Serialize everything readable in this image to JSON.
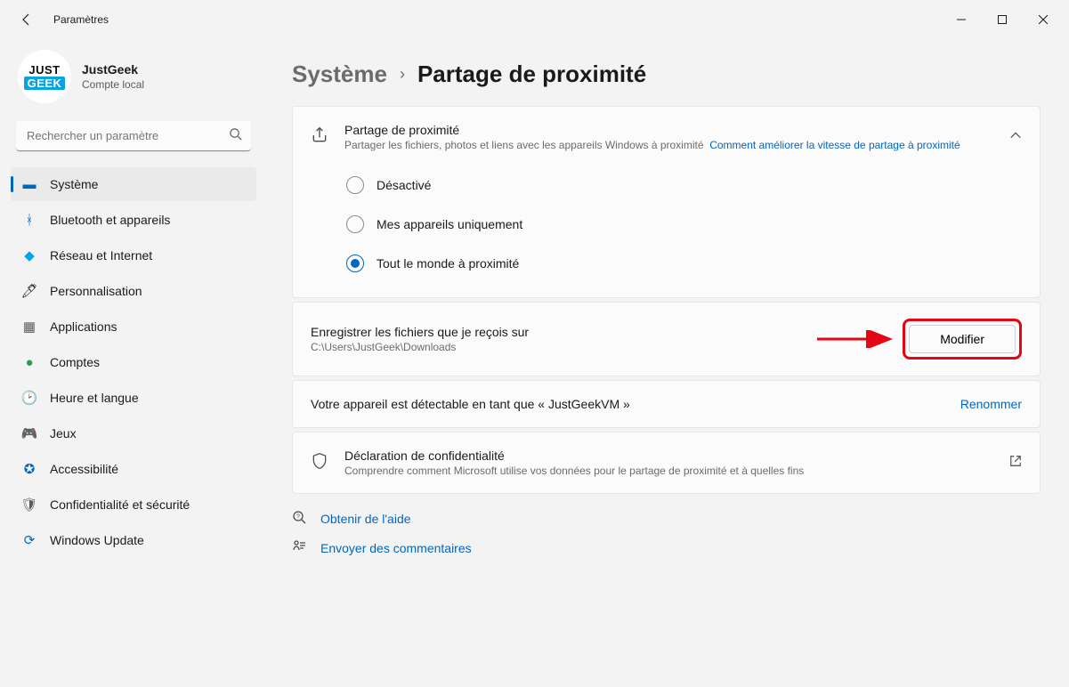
{
  "window": {
    "title": "Paramètres"
  },
  "profile": {
    "name": "JustGeek",
    "account_type": "Compte local",
    "logo_top": "JUST",
    "logo_bottom": "GEEK"
  },
  "search": {
    "placeholder": "Rechercher un paramètre"
  },
  "sidebar": {
    "items": [
      {
        "label": "Système",
        "icon": "🖥️"
      },
      {
        "label": "Bluetooth et appareils",
        "icon": "ᛒ"
      },
      {
        "label": "Réseau et Internet",
        "icon": "📶"
      },
      {
        "label": "Personnalisation",
        "icon": "🖌️"
      },
      {
        "label": "Applications",
        "icon": "▦"
      },
      {
        "label": "Comptes",
        "icon": "👤"
      },
      {
        "label": "Heure et langue",
        "icon": "🌐"
      },
      {
        "label": "Jeux",
        "icon": "🎮"
      },
      {
        "label": "Accessibilité",
        "icon": "♿"
      },
      {
        "label": "Confidentialité et sécurité",
        "icon": "🛡️"
      },
      {
        "label": "Windows Update",
        "icon": "🔄"
      }
    ]
  },
  "breadcrumb": {
    "root": "Système",
    "leaf": "Partage de proximité"
  },
  "main_card": {
    "title": "Partage de proximité",
    "subtitle": "Partager les fichiers, photos et liens avec les appareils Windows à proximité",
    "link": "Comment améliorer la vitesse de partage à proximité",
    "radios": [
      {
        "label": "Désactivé"
      },
      {
        "label": "Mes appareils uniquement"
      },
      {
        "label": "Tout le monde à proximité"
      }
    ],
    "selected_index": 2
  },
  "save_location": {
    "title": "Enregistrer les fichiers que je reçois sur",
    "path": "C:\\Users\\JustGeek\\Downloads",
    "button": "Modifier"
  },
  "discoverable": {
    "text": "Votre appareil est détectable en tant que « JustGeekVM »",
    "action": "Renommer"
  },
  "privacy": {
    "title": "Déclaration de confidentialité",
    "subtitle": "Comprendre comment Microsoft utilise vos données pour le partage de proximité et à quelles fins"
  },
  "footer_links": {
    "help": "Obtenir de l'aide",
    "feedback": "Envoyer des commentaires"
  },
  "watermark": {
    "a": "JUST",
    "b": "GEEK"
  }
}
